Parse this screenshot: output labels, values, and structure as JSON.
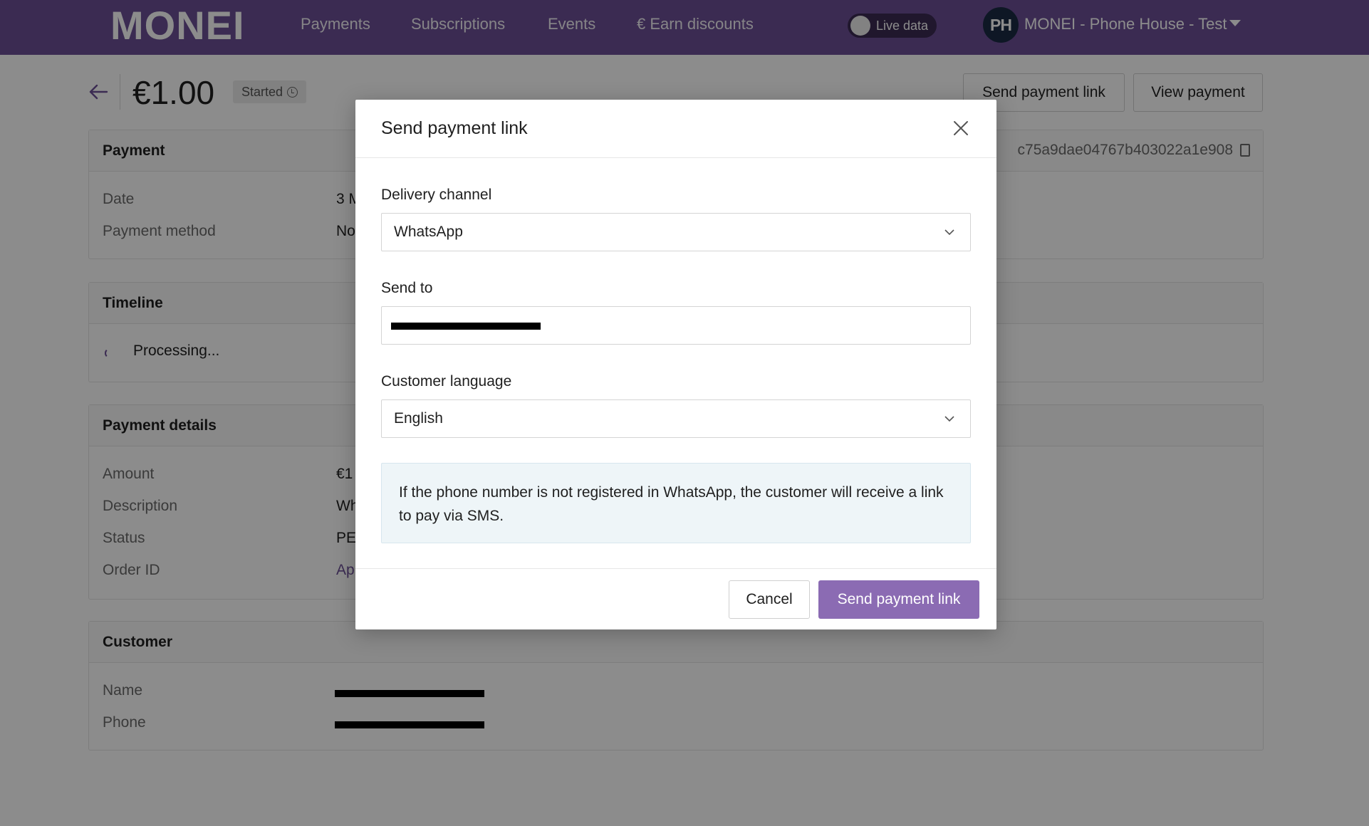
{
  "topbar": {
    "logo": "MONEI",
    "nav": [
      "Payments",
      "Subscriptions",
      "Events",
      "€ Earn discounts"
    ],
    "live_toggle_label": "Live data",
    "avatar_initials": "PH",
    "account_name": "MONEI - Phone House - Test",
    "brand_color": "#6c4f95"
  },
  "header": {
    "amount": "€1.00",
    "status": "Started",
    "send_link_button": "Send payment link",
    "view_payment_button": "View payment"
  },
  "payment_card": {
    "title": "Payment",
    "id_fragment": "c75a9dae04767b403022a1e908",
    "rows": [
      {
        "label": "Date",
        "value": "3 M"
      },
      {
        "label": "Payment method",
        "value": "No"
      }
    ]
  },
  "timeline_card": {
    "title": "Timeline",
    "processing": "Processing..."
  },
  "details_card": {
    "title": "Payment details",
    "rows": [
      {
        "label": "Amount",
        "value": "€1"
      },
      {
        "label": "Description",
        "value": "Wh"
      },
      {
        "label": "Status",
        "value": "PE"
      },
      {
        "label": "Order ID",
        "value": "Ap"
      }
    ]
  },
  "customer_card": {
    "title": "Customer",
    "rows": [
      {
        "label": "Name",
        "value": ""
      },
      {
        "label": "Phone",
        "value": ""
      }
    ]
  },
  "modal": {
    "title": "Send payment link",
    "delivery_label": "Delivery channel",
    "delivery_value": "WhatsApp",
    "send_to_label": "Send to",
    "send_to_value": "",
    "language_label": "Customer language",
    "language_value": "English",
    "info": "If the phone number is not registered in WhatsApp, the customer will receive a link to pay via SMS.",
    "cancel_button": "Cancel",
    "submit_button": "Send payment link",
    "primary_color": "#8b6bb3"
  }
}
